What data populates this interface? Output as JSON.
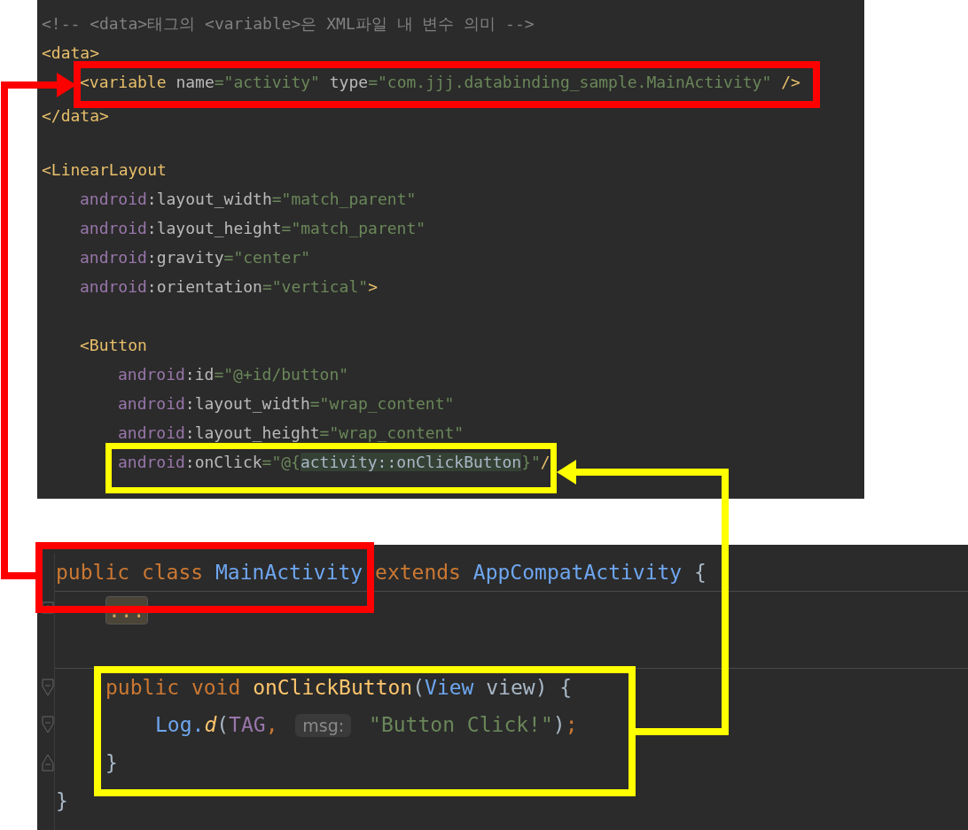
{
  "xml_editor": {
    "lines": [
      {
        "kind": "code",
        "tokens": [
          {
            "text": "<!-- <data>태그의 <variable>은 XML파일 내 변수 의미 -->",
            "kind": "comment"
          }
        ]
      },
      {
        "kind": "code",
        "tokens": [
          {
            "text": "<data>",
            "kind": "tag"
          }
        ],
        "children": [
          {
            "kind": "code",
            "tokens": [
              {
                "text": "<variable ",
                "kind": "tag"
              },
              {
                "text": "name",
                "kind": "attr"
              },
              {
                "text": "=\"activity\" ",
                "kind": "str"
              },
              {
                "text": "type",
                "kind": "attr"
              },
              {
                "text": "=\"com.jjj.databinding_sample.MainActivity\" ",
                "kind": "str"
              },
              {
                "text": "/>",
                "kind": "tag"
              }
            ]
          }
        ]
      },
      {
        "kind": "code",
        "tokens": [
          {
            "text": "</data>",
            "kind": "tag"
          }
        ]
      },
      {
        "kind": "blank"
      },
      {
        "kind": "code",
        "tokens": [
          {
            "text": "<LinearLayout",
            "kind": "tag"
          }
        ],
        "children": [
          {
            "kind": "code",
            "tokens": [
              {
                "text": "android",
                "kind": "ns"
              },
              {
                "text": ":layout_width",
                "kind": "attr"
              },
              {
                "text": "=\"match_parent\"",
                "kind": "str"
              }
            ]
          },
          {
            "kind": "code",
            "tokens": [
              {
                "text": "android",
                "kind": "ns"
              },
              {
                "text": ":layout_height",
                "kind": "attr"
              },
              {
                "text": "=\"match_parent\"",
                "kind": "str"
              }
            ]
          },
          {
            "kind": "code",
            "tokens": [
              {
                "text": "android",
                "kind": "ns"
              },
              {
                "text": ":gravity",
                "kind": "attr"
              },
              {
                "text": "=\"center\"",
                "kind": "str"
              }
            ]
          },
          {
            "kind": "code",
            "tokens": [
              {
                "text": "android",
                "kind": "ns"
              },
              {
                "text": ":orientation",
                "kind": "attr"
              },
              {
                "text": "=\"vertical\"",
                "kind": "str"
              },
              {
                "text": ">",
                "kind": "tag"
              }
            ]
          },
          {
            "kind": "blank"
          },
          {
            "kind": "code",
            "tokens": [
              {
                "text": "<Button",
                "kind": "tag"
              }
            ],
            "children": [
              {
                "kind": "code",
                "tokens": [
                  {
                    "text": "android",
                    "kind": "ns"
                  },
                  {
                    "text": ":id",
                    "kind": "attr"
                  },
                  {
                    "text": "=\"@+id/button\"",
                    "kind": "str"
                  }
                ]
              },
              {
                "kind": "code",
                "tokens": [
                  {
                    "text": "android",
                    "kind": "ns"
                  },
                  {
                    "text": ":layout_width",
                    "kind": "attr"
                  },
                  {
                    "text": "=\"wrap_content\"",
                    "kind": "str"
                  }
                ]
              },
              {
                "kind": "code",
                "tokens": [
                  {
                    "text": "android",
                    "kind": "ns"
                  },
                  {
                    "text": ":layout_height",
                    "kind": "attr"
                  },
                  {
                    "text": "=\"wrap_content\"",
                    "kind": "str"
                  }
                ]
              },
              {
                "kind": "code",
                "tokens": [
                  {
                    "text": "android",
                    "kind": "ns"
                  },
                  {
                    "text": ":onClick",
                    "kind": "attr"
                  },
                  {
                    "text": "=\"@{",
                    "kind": "str"
                  },
                  {
                    "text": "activity::onClickButton",
                    "kind": "highlight"
                  },
                  {
                    "text": "}\"",
                    "kind": "str"
                  },
                  {
                    "text": "/",
                    "kind": "tag"
                  }
                ]
              }
            ]
          }
        ]
      }
    ]
  },
  "java_editor": {
    "lines": [
      {
        "kind": "code",
        "divider_below": true,
        "tokens": [
          {
            "text": "public class ",
            "kind": "kw"
          },
          {
            "text": "MainActivity",
            "kind": "cls"
          },
          {
            "text": " extends ",
            "kind": "kw"
          },
          {
            "text": "AppCompatActivity",
            "kind": "cls"
          },
          {
            "text": " {",
            "kind": "plain"
          }
        ],
        "children": [
          {
            "kind": "folded",
            "tokens": [
              {
                "text": "...",
                "kind": "fold"
              }
            ]
          },
          {
            "kind": "blank"
          },
          {
            "kind": "fold_start",
            "divider_above": true,
            "tokens": [
              {
                "text": "public void ",
                "kind": "kw"
              },
              {
                "text": "onClickButton",
                "kind": "fn"
              },
              {
                "text": "(",
                "kind": "plain"
              },
              {
                "text": "View",
                "kind": "cls"
              },
              {
                "text": " view) {",
                "kind": "plain"
              }
            ],
            "children": [
              {
                "kind": "fold_start",
                "tokens": [
                  {
                    "text": "Log.",
                    "kind": "cls"
                  },
                  {
                    "text": "d",
                    "kind": "static"
                  },
                  {
                    "text": "(",
                    "kind": "plain"
                  },
                  {
                    "text": "TAG",
                    "kind": "const"
                  },
                  {
                    "text": ", ",
                    "kind": "kw"
                  },
                  {
                    "text": "msg:",
                    "kind": "hint"
                  },
                  {
                    "text": " \"Button Click!\"",
                    "kind": "str"
                  },
                  {
                    "text": ")",
                    "kind": "plain"
                  },
                  {
                    "text": ";",
                    "kind": "kw"
                  }
                ]
              }
            ]
          },
          {
            "kind": "fold_end",
            "tokens": [
              {
                "text": "}",
                "kind": "plain"
              }
            ]
          }
        ]
      },
      {
        "kind": "code",
        "tokens": [
          {
            "text": "}",
            "kind": "plain"
          }
        ]
      }
    ]
  },
  "annotations": [
    {
      "color": "#ff0000"
    },
    {
      "color": "#ffff00"
    }
  ]
}
